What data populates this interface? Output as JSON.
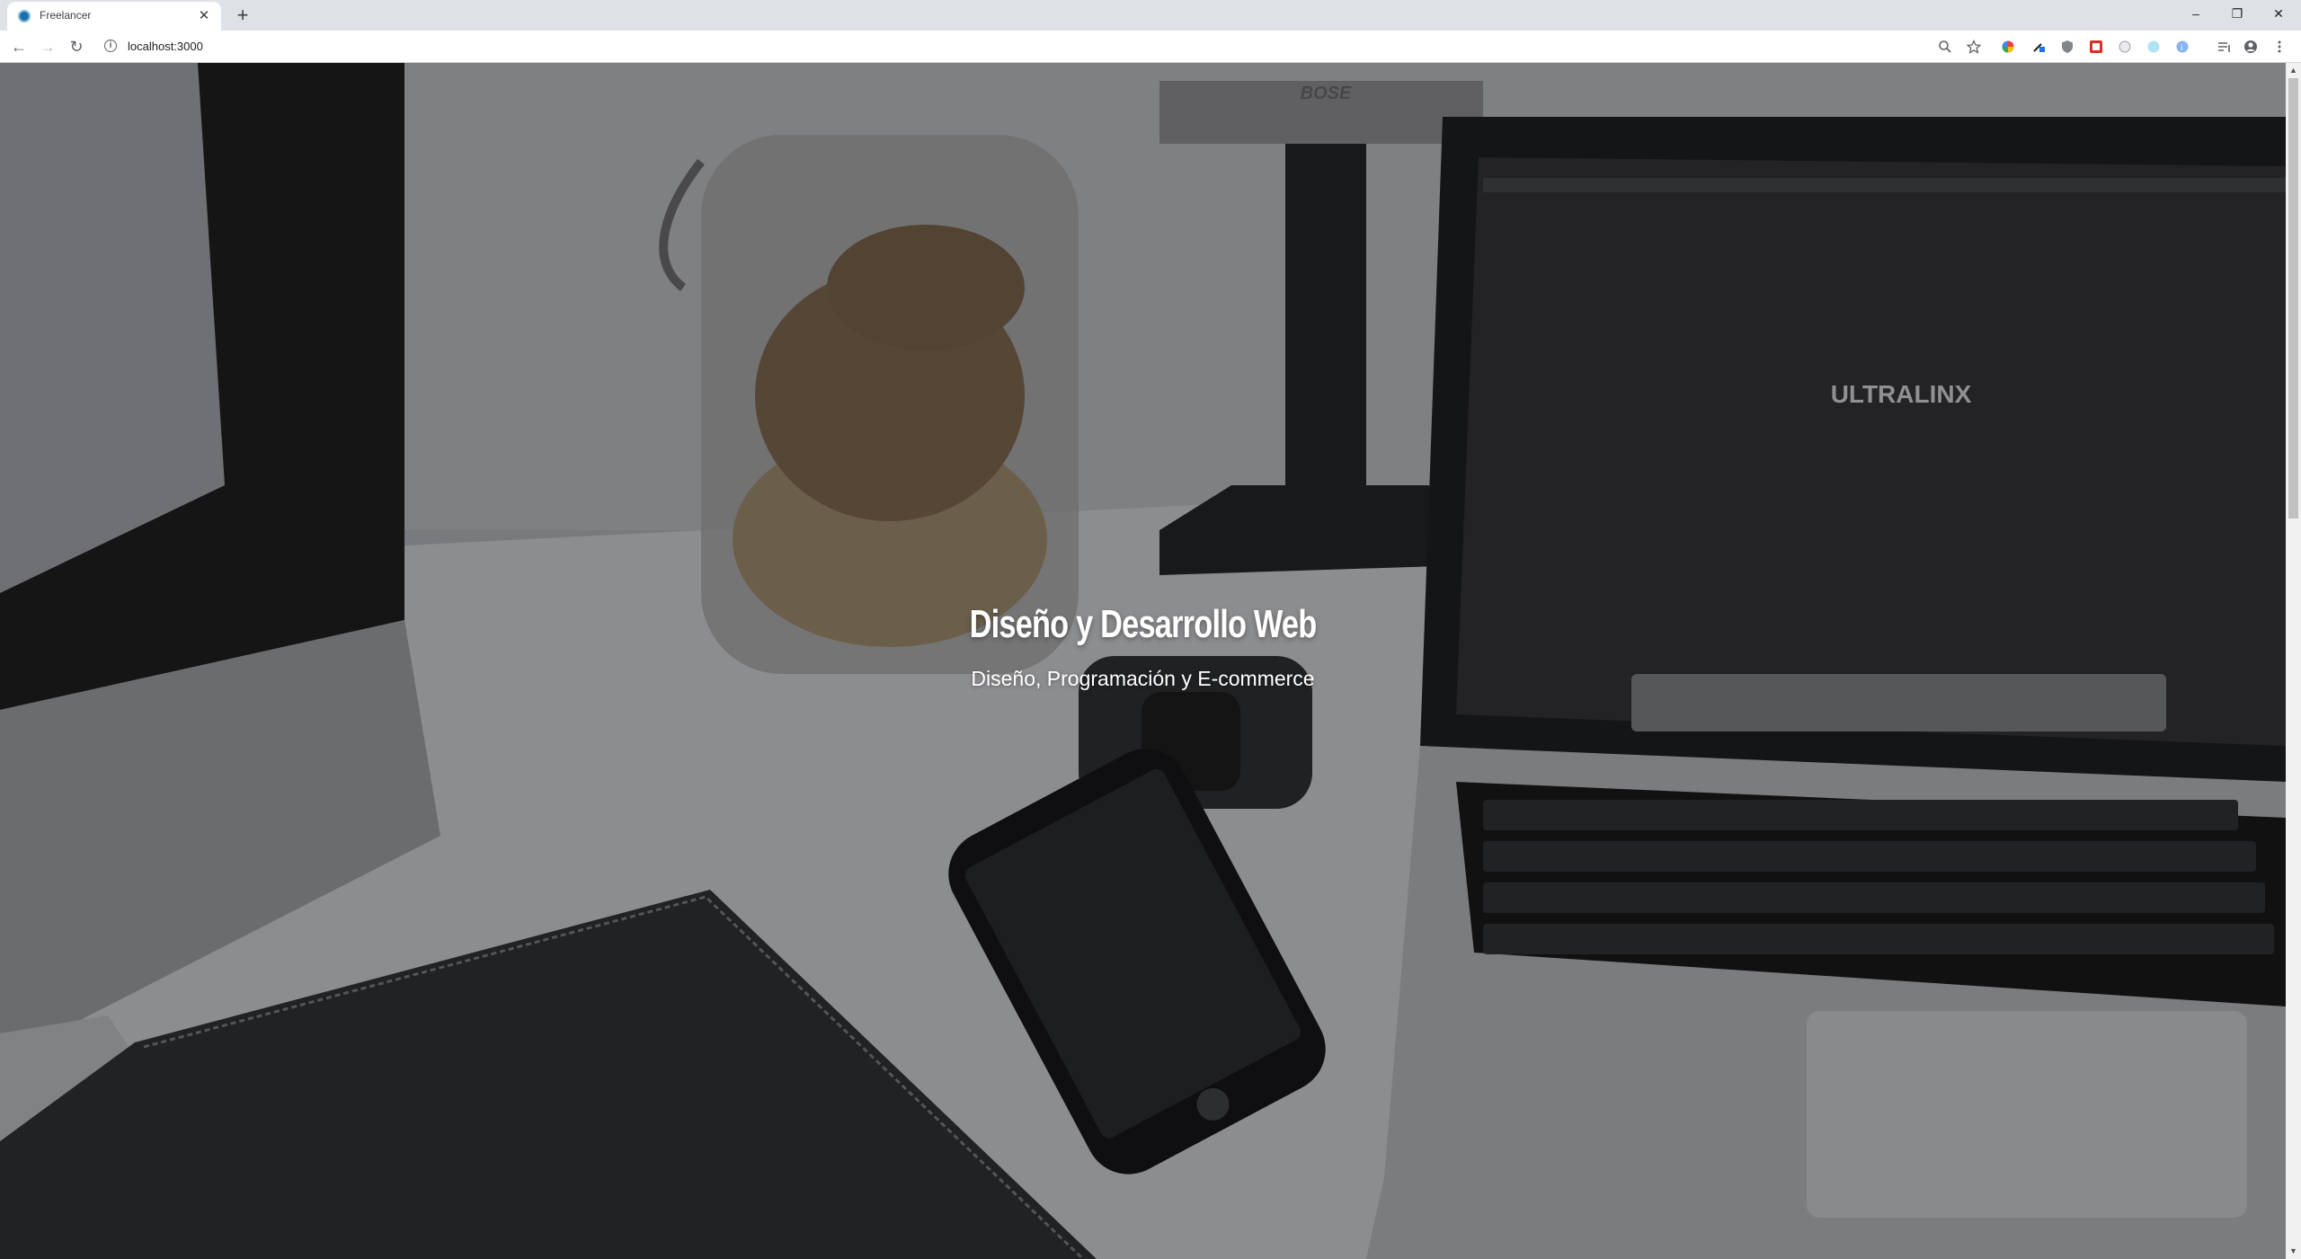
{
  "browser": {
    "tab": {
      "title": "Freelancer",
      "close_glyph": "✕"
    },
    "new_tab_glyph": "+",
    "window_controls": {
      "minimize": "–",
      "restore": "❐",
      "close": "✕"
    },
    "nav": {
      "back": "←",
      "forward": "→",
      "reload": "↻"
    },
    "address": {
      "url": "localhost:3000",
      "info_glyph": "i"
    },
    "toolbar_icons": [
      "zoom-icon",
      "star-icon",
      "extension-icons",
      "profile-icon",
      "menu-icon"
    ]
  },
  "hero": {
    "title": "Diseño y Desarrollo Web",
    "subtitle": "Diseño, Programación y E-commerce",
    "background_scene": "desk with monitor, cookie jar, speaker, laptop, phone, watch, notebook",
    "laptop_screen_text": "ULTRALINX",
    "speaker_brand": "BOSE"
  },
  "colors": {
    "tabstrip": "#dee1e6",
    "toolbar": "#ffffff",
    "hero_text": "#ffffff",
    "overlay": "#000000"
  }
}
